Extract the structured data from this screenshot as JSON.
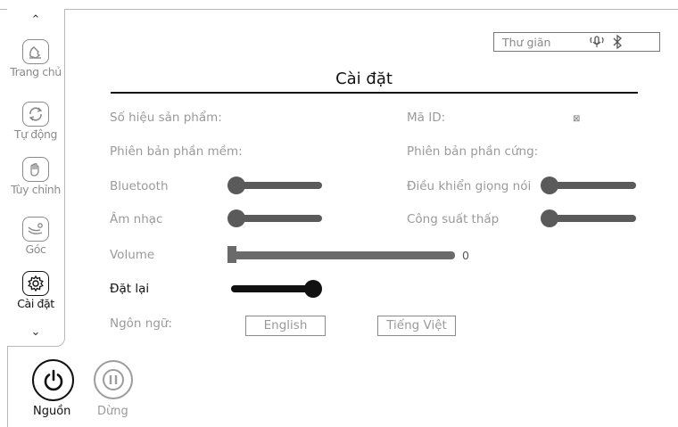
{
  "sidebar": {
    "items": [
      {
        "label": "Trang chủ",
        "icon": "home-hand-icon"
      },
      {
        "label": "Tự động",
        "icon": "auto-cycle-icon"
      },
      {
        "label": "Tùy chỉnh",
        "icon": "custom-hand-icon"
      },
      {
        "label": "Góc",
        "icon": "recline-angle-icon"
      },
      {
        "label": "Cài đặt",
        "icon": "gear-icon"
      }
    ],
    "active": "Cài đặt"
  },
  "bottom": {
    "power_label": "Nguồn",
    "pause_label": "Dừng"
  },
  "status": {
    "mode": "Thư giãn",
    "icons": [
      "voice-icon",
      "bluetooth-icon"
    ]
  },
  "page": {
    "title": "Cài đặt"
  },
  "info": {
    "product_number_label": "Số hiệu sản phẩm:",
    "id_label": "Mã ID:",
    "id_value": "⊠",
    "software_version_label": "Phiên bản phần mềm:",
    "hardware_version_label": "Phiên bản phần cứng:"
  },
  "toggles": {
    "bluetooth_label": "Bluetooth",
    "bluetooth_on": false,
    "voice_control_label": "Điều khiển giọng nói",
    "voice_control_on": false,
    "music_label": "Âm nhạc",
    "music_on": false,
    "low_power_label": "Công suất thấp",
    "low_power_on": false,
    "reset_label": "Đặt lại",
    "reset_on": true
  },
  "volume": {
    "label": "Volume",
    "value": "0"
  },
  "language": {
    "label": "Ngôn ngữ:",
    "options": [
      "English",
      "Tiếng Việt"
    ]
  },
  "colors": {
    "active": "#111111",
    "inactive": "#9a9a9a",
    "toggle_off": "#5a5a5a"
  }
}
